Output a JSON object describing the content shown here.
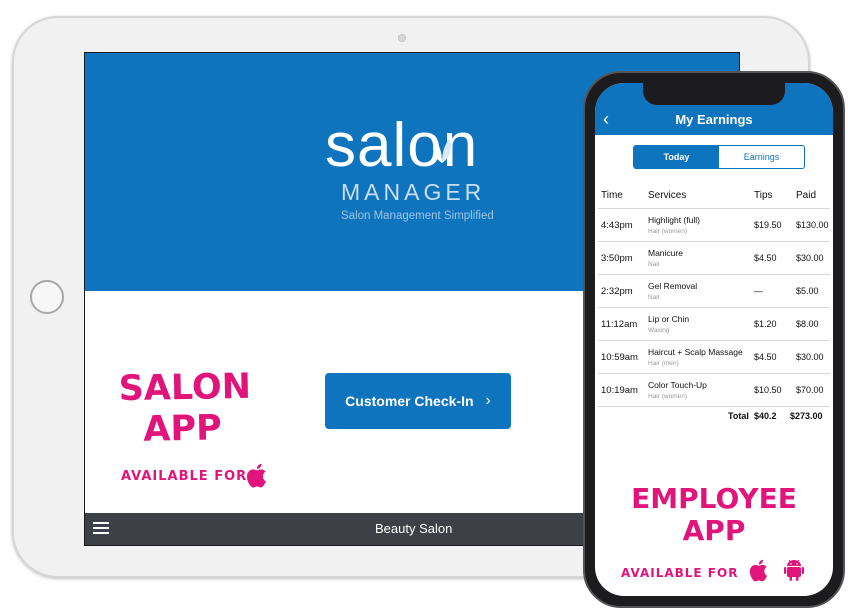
{
  "tablet": {
    "logo_word": "salon",
    "logo_sub": "MANAGER",
    "tagline": "Salon Management Simplified",
    "app_label_line1": "SALON",
    "app_label_line2": "APP",
    "available_for": "AVAILABLE FOR",
    "checkin_label": "Customer Check-In",
    "checkin_chevron": "›",
    "bottom_title": "Beauty Salon"
  },
  "phone": {
    "back_glyph": "‹",
    "title": "My Earnings",
    "segments": [
      "Today",
      "Earnings"
    ],
    "columns": [
      "Time",
      "Services",
      "Tips",
      "Paid"
    ],
    "rows": [
      {
        "time": "4:43pm",
        "service": "Highlight (full)",
        "category": "Hair (women)",
        "tips": "$19.50",
        "paid": "$130.00"
      },
      {
        "time": "3:50pm",
        "service": "Manicure",
        "category": "Nail",
        "tips": "$4.50",
        "paid": "$30.00"
      },
      {
        "time": "2:32pm",
        "service": "Gel Removal",
        "category": "Nail",
        "tips": "—",
        "paid": "$5.00"
      },
      {
        "time": "11:12am",
        "service": "Lip or Chin",
        "category": "Waxing",
        "tips": "$1.20",
        "paid": "$8.00"
      },
      {
        "time": "10:59am",
        "service": "Haircut + Scalp Massage",
        "category": "Hair (men)",
        "tips": "$4.50",
        "paid": "$30.00"
      },
      {
        "time": "10:19am",
        "service": "Color Touch-Up",
        "category": "Hair (women)",
        "tips": "$10.50",
        "paid": "$70.00"
      }
    ],
    "total_label": "Total",
    "total_tips": "$40.2",
    "total_paid": "$273.00",
    "app_label_line1": "EMPLOYEE",
    "app_label_line2": "APP",
    "available_for": "AVAILABLE FOR"
  },
  "colors": {
    "brand_blue": "#0f74be",
    "accent_pink": "#e0147b",
    "toolbar_dark": "#3d4147"
  },
  "icons": [
    "apple-icon",
    "android-icon",
    "leaf-icon",
    "hamburger-icon",
    "back-chevron-icon"
  ]
}
